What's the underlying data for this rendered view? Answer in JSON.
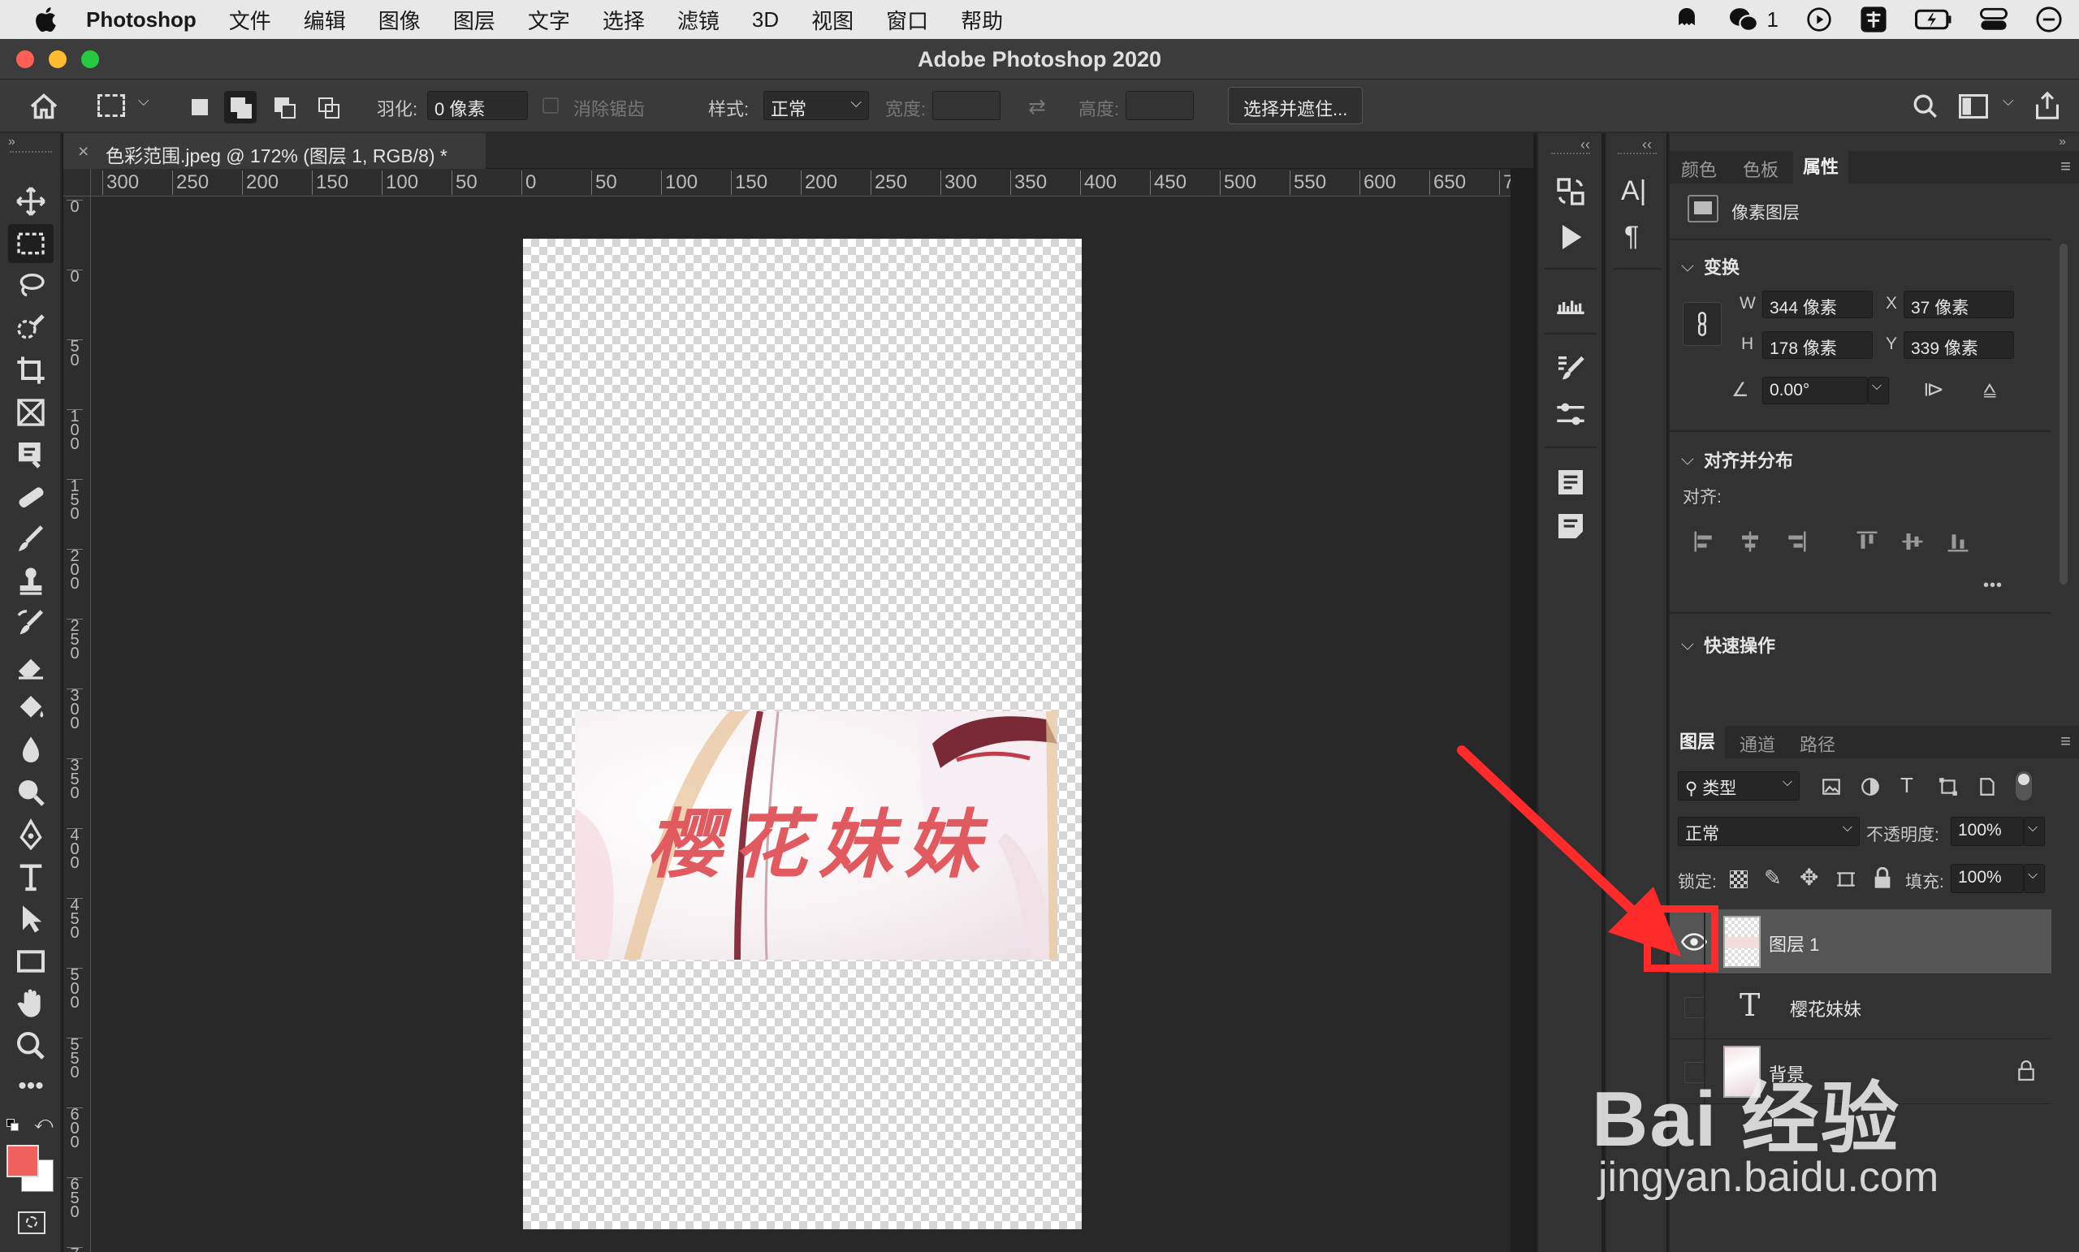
{
  "menubar": {
    "app_name": "Photoshop",
    "items": [
      "文件",
      "编辑",
      "图像",
      "图层",
      "文字",
      "选择",
      "滤镜",
      "3D",
      "视图",
      "窗口",
      "帮助"
    ],
    "wechat_count": "1"
  },
  "window": {
    "title": "Adobe Photoshop 2020"
  },
  "options": {
    "feather_label": "羽化:",
    "feather_value": "0 像素",
    "antialias_label": "消除锯齿",
    "style_label": "样式:",
    "style_value": "正常",
    "width_label": "宽度:",
    "height_label": "高度:",
    "select_mask_button": "选择并遮住..."
  },
  "document": {
    "tab_title": "色彩范围.jpeg @ 172% (图层 1, RGB/8) *",
    "close_glyph": "×",
    "art_text": "樱花妹妹"
  },
  "rulers": {
    "horizontal": [
      "300",
      "250",
      "200",
      "150",
      "100",
      "50",
      "0",
      "50",
      "100",
      "150",
      "200",
      "250",
      "300",
      "350",
      "400",
      "450",
      "500",
      "550",
      "600",
      "650",
      "7"
    ],
    "vertical": [
      "0",
      "0",
      "5\n0",
      "1\n0\n0",
      "1\n5\n0",
      "2\n0\n0",
      "2\n5\n0",
      "3\n0\n0",
      "3\n5\n0",
      "4\n0\n0",
      "4\n5\n0",
      "5\n0\n0",
      "5\n5\n0",
      "6\n0\n0",
      "6\n5\n0",
      "7"
    ]
  },
  "properties_panel": {
    "tabs": [
      "颜色",
      "色板",
      "属性"
    ],
    "active_tab": "属性",
    "kind_label": "像素图层",
    "transform_title": "变换",
    "w_label": "W",
    "w_value": "344 像素",
    "h_label": "H",
    "h_value": "178 像素",
    "x_label": "X",
    "x_value": "37 像素",
    "y_label": "Y",
    "y_value": "339 像素",
    "angle_value": "0.00°",
    "align_title": "对齐并分布",
    "align_label": "对齐:",
    "more_glyph": "•••",
    "quick_actions_title": "快速操作"
  },
  "layers_panel": {
    "tabs": [
      "图层",
      "通道",
      "路径"
    ],
    "active_tab": "图层",
    "filter_value": "类型",
    "blend_mode": "正常",
    "opacity_label": "不透明度:",
    "opacity_value": "100%",
    "lock_label": "锁定:",
    "fill_label": "填充:",
    "fill_value": "100%",
    "layers": [
      {
        "name": "图层 1",
        "visible": true,
        "selected": true,
        "kind": "pixel"
      },
      {
        "name": "樱花妹妹",
        "visible": false,
        "selected": false,
        "kind": "text"
      },
      {
        "name": "背景",
        "visible": false,
        "selected": false,
        "kind": "background",
        "locked": true
      }
    ]
  },
  "watermark": {
    "line1": "Bai 经验",
    "line2": "jingyan.baidu.com"
  },
  "colors": {
    "foreground": "#f0605c",
    "background": "#ffffff",
    "highlight_red": "#ff2a2a",
    "art_text": "#e15a60"
  }
}
